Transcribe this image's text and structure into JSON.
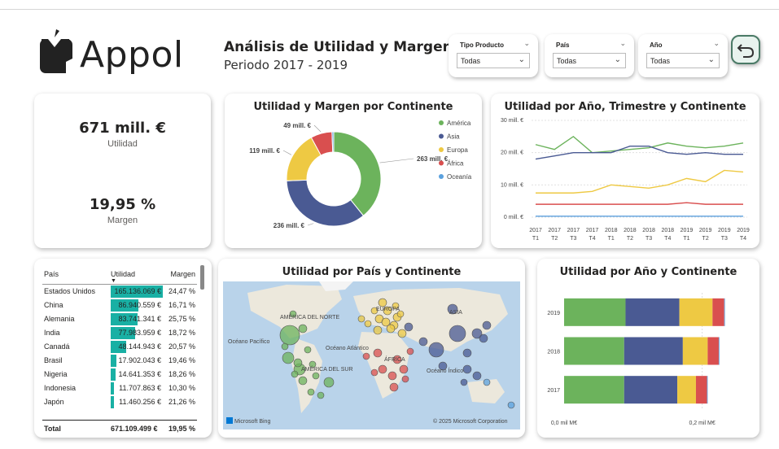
{
  "header": {
    "logo_text": "Appol",
    "title": "Análisis de Utilidad y Margen",
    "subtitle": "Periodo 2017 - 2019"
  },
  "slicers": [
    {
      "label": "Tipo Producto",
      "value": "Todas"
    },
    {
      "label": "País",
      "value": "Todas"
    },
    {
      "label": "Año",
      "value": "Todas"
    }
  ],
  "kpi": {
    "utilidad_value": "671 mill. €",
    "utilidad_label": "Utilidad",
    "margen_value": "19,95 %",
    "margen_label": "Margen"
  },
  "colors": {
    "america": "#6cb35c",
    "asia": "#4a5a93",
    "europa": "#eec943",
    "africa": "#d94f4f",
    "oceania": "#5ba1de",
    "table_bar": "#19b0a4"
  },
  "table": {
    "headers": [
      "País",
      "Utilidad",
      "Margen"
    ],
    "rows": [
      {
        "pais": "Estados Unidos",
        "utilidad": "165.136.069 €",
        "margen": "24,47 %",
        "frac": 1.0
      },
      {
        "pais": "China",
        "utilidad": "86.940.559 €",
        "margen": "16,71 %",
        "frac": 0.53
      },
      {
        "pais": "Alemania",
        "utilidad": "83.741.341 €",
        "margen": "25,75 %",
        "frac": 0.51
      },
      {
        "pais": "India",
        "utilidad": "77.983.959 €",
        "margen": "18,72 %",
        "frac": 0.47
      },
      {
        "pais": "Canadá",
        "utilidad": "48.144.943 €",
        "margen": "20,57 %",
        "frac": 0.29
      },
      {
        "pais": "Brasil",
        "utilidad": "17.902.043 €",
        "margen": "19,46 %",
        "frac": 0.11
      },
      {
        "pais": "Nigeria",
        "utilidad": "14.641.353 €",
        "margen": "18,26 %",
        "frac": 0.09
      },
      {
        "pais": "Indonesia",
        "utilidad": "11.707.863 €",
        "margen": "10,30 %",
        "frac": 0.07
      },
      {
        "pais": "Japón",
        "utilidad": "11.460.256 €",
        "margen": "21,26 %",
        "frac": 0.07
      }
    ],
    "total_label": "Total",
    "total_utilidad": "671.109.499 €",
    "total_margen": "19,95 %"
  },
  "map": {
    "title": "Utilidad por País y Continente",
    "labels": [
      "AMÉRICA DEL NORTE",
      "EUROPA",
      "ASIA",
      "ÁFRICA",
      "AMÉRICA DEL SUR",
      "Océano Pacífico",
      "Océano Atlántico",
      "Océano Índico"
    ],
    "credit_left": "Microsoft Bing",
    "credit_right": "© 2025 Microsoft Corporation"
  },
  "chart_data": [
    {
      "type": "pie",
      "title": "Utilidad y Margen por Continente",
      "categories": [
        "América",
        "Asia",
        "Europa",
        "África",
        "Oceanía"
      ],
      "values": [
        263,
        236,
        119,
        49,
        4
      ],
      "data_labels": [
        "263 mill. €",
        "236 mill. €",
        "119 mill. €",
        "49 mill. €",
        ""
      ],
      "legend": "right"
    },
    {
      "type": "line",
      "title": "Utilidad por Año, Trimestre y Continente",
      "x": [
        "2017 T1",
        "2017 T2",
        "2017 T3",
        "2017 T4",
        "2018 T1",
        "2018 T2",
        "2018 T3",
        "2018 T4",
        "2019 T1",
        "2019 T2",
        "2019 T3",
        "2019 T4"
      ],
      "x_top": [
        "2017",
        "2017",
        "2017",
        "2017",
        "2018",
        "2018",
        "2018",
        "2018",
        "2019",
        "2019",
        "2019",
        "2019"
      ],
      "x_bottom": [
        "T1",
        "T2",
        "T3",
        "T4",
        "T1",
        "T2",
        "T3",
        "T4",
        "T1",
        "T2",
        "T3",
        "T4"
      ],
      "ylim": [
        0,
        30
      ],
      "yticks": [
        "0 mill. €",
        "10 mill. €",
        "20 mill. €",
        "30 mill. €"
      ],
      "series": [
        {
          "name": "América",
          "values": [
            22.5,
            21,
            25,
            20,
            20.5,
            21,
            21.5,
            23,
            22,
            21.5,
            22,
            23
          ]
        },
        {
          "name": "Asia",
          "values": [
            18,
            19,
            20,
            20,
            20,
            22,
            22,
            20,
            19.5,
            20,
            19.5,
            19.5
          ]
        },
        {
          "name": "Europa",
          "values": [
            7.5,
            7.5,
            7.5,
            8,
            10,
            9.5,
            9,
            10,
            12,
            11,
            14.5,
            14
          ]
        },
        {
          "name": "África",
          "values": [
            4,
            4,
            4,
            4,
            4,
            4,
            4,
            4,
            4.5,
            4,
            4,
            4
          ]
        },
        {
          "name": "Oceanía",
          "values": [
            0.3,
            0.3,
            0.3,
            0.3,
            0.3,
            0.3,
            0.3,
            0.3,
            0.3,
            0.3,
            0.3,
            0.3
          ]
        }
      ]
    },
    {
      "type": "bar",
      "title": "Utilidad por Año y Continente",
      "orientation": "horizontal",
      "stacked": true,
      "categories": [
        "2019",
        "2018",
        "2017"
      ],
      "xticks": [
        "0,0 mil M€",
        "0,2 mil M€"
      ],
      "xlim": [
        0,
        0.25
      ],
      "series": [
        {
          "name": "América",
          "values": [
            0.089,
            0.087,
            0.087
          ]
        },
        {
          "name": "Asia",
          "values": [
            0.078,
            0.085,
            0.077
          ]
        },
        {
          "name": "Europa",
          "values": [
            0.048,
            0.036,
            0.027
          ]
        },
        {
          "name": "África",
          "values": [
            0.017,
            0.016,
            0.016
          ]
        },
        {
          "name": "Oceanía",
          "values": [
            0.001,
            0.001,
            0.001
          ]
        }
      ]
    }
  ]
}
